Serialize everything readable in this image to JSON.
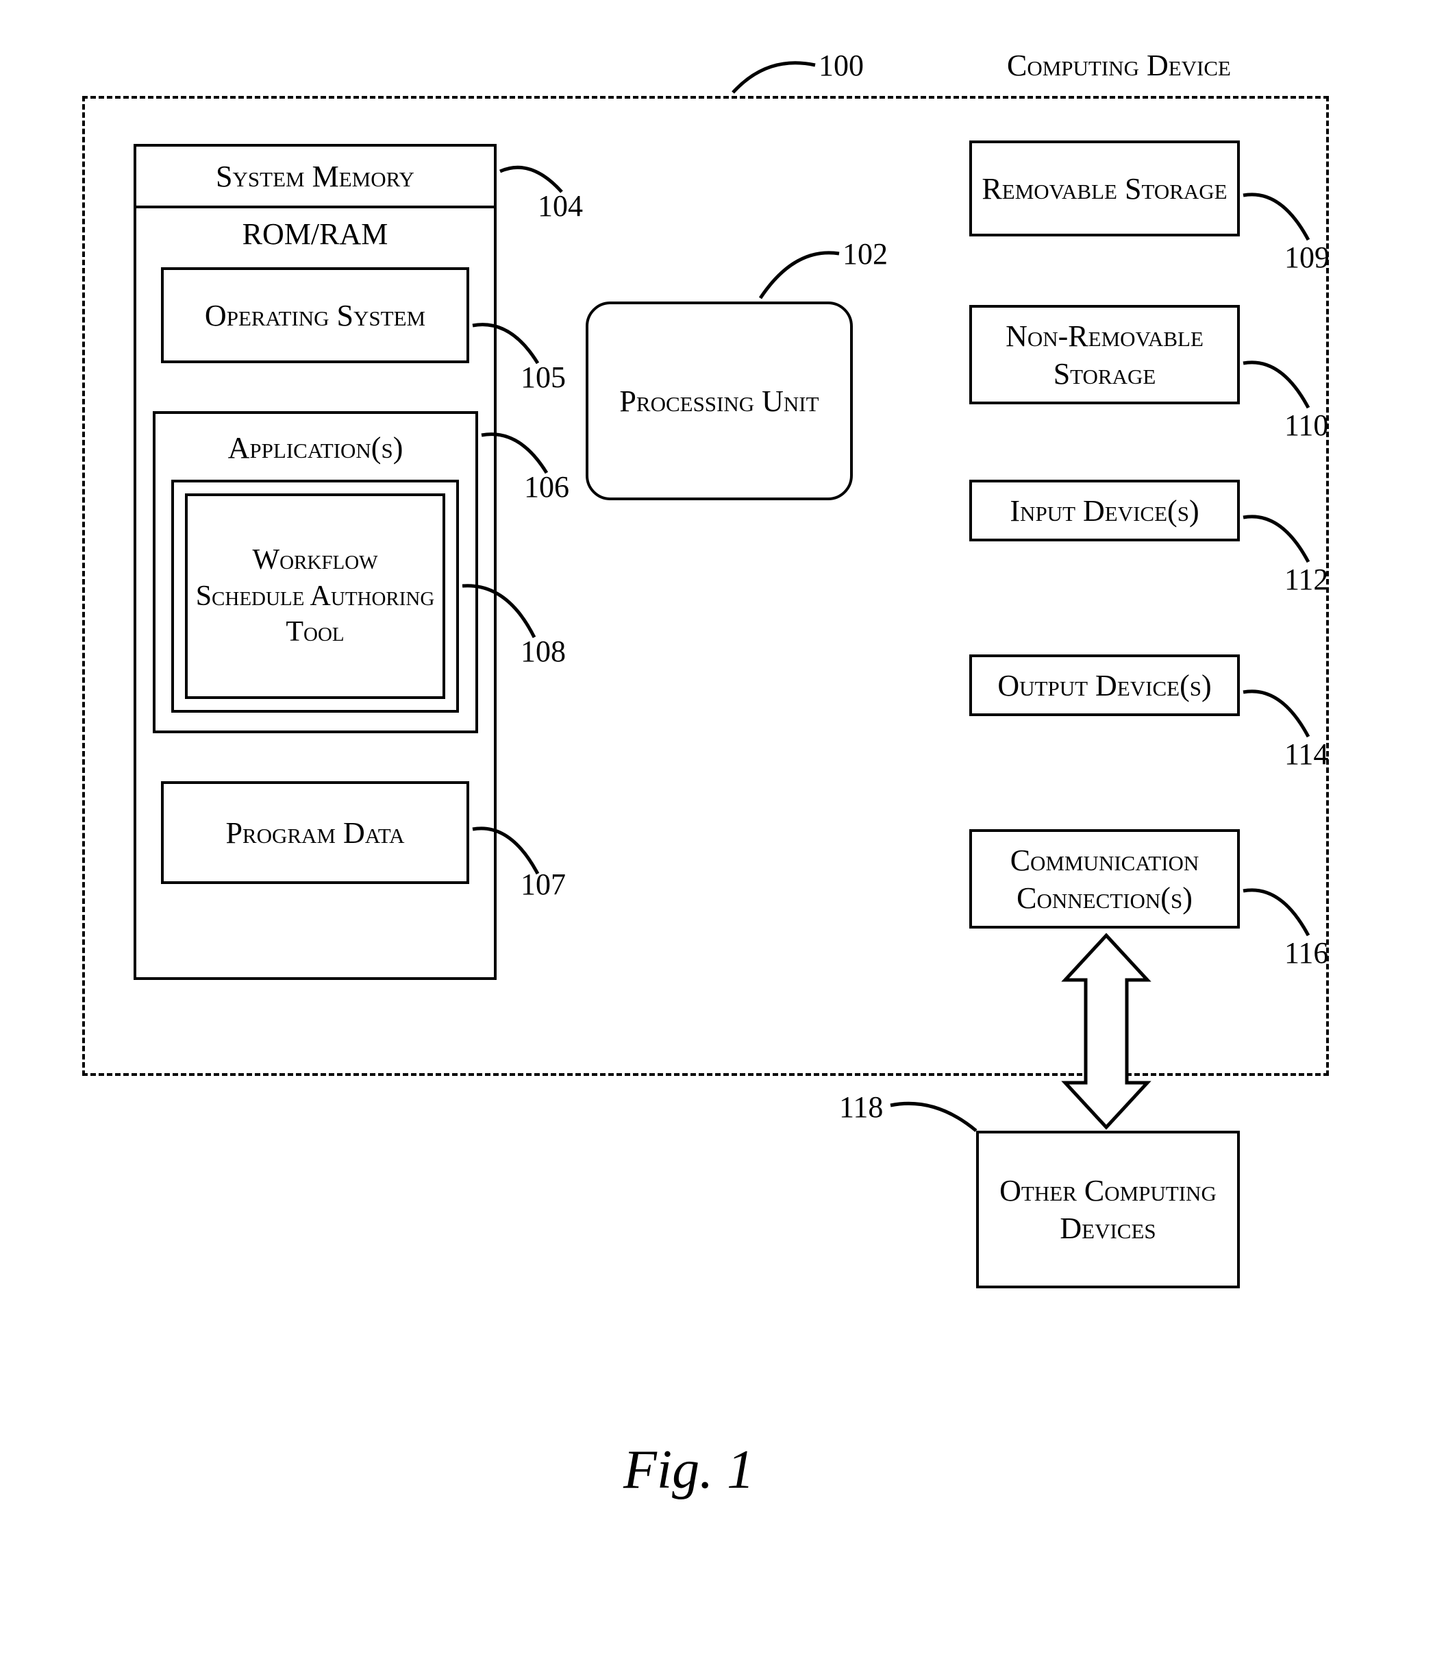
{
  "title": "Computing Device",
  "refs": {
    "r100": "100",
    "r102": "102",
    "r104": "104",
    "r105": "105",
    "r106": "106",
    "r107": "107",
    "r108": "108",
    "r109": "109",
    "r110": "110",
    "r112": "112",
    "r114": "114",
    "r116": "116",
    "r118": "118"
  },
  "boxes": {
    "system_memory": "System Memory",
    "rom_ram": "ROM/RAM",
    "operating_system": "Operating System",
    "applications": "Application(s)",
    "workflow_tool": "Workflow Schedule Authoring Tool",
    "program_data": "Program Data",
    "processing_unit": "Processing Unit",
    "removable_storage": "Removable Storage",
    "non_removable_storage": "Non-Removable Storage",
    "input_devices": "Input Device(s)",
    "output_devices": "Output Device(s)",
    "comm_connections": "Communication Connection(s)",
    "other_devices": "Other Computing Devices"
  },
  "figure": "Fig. 1"
}
